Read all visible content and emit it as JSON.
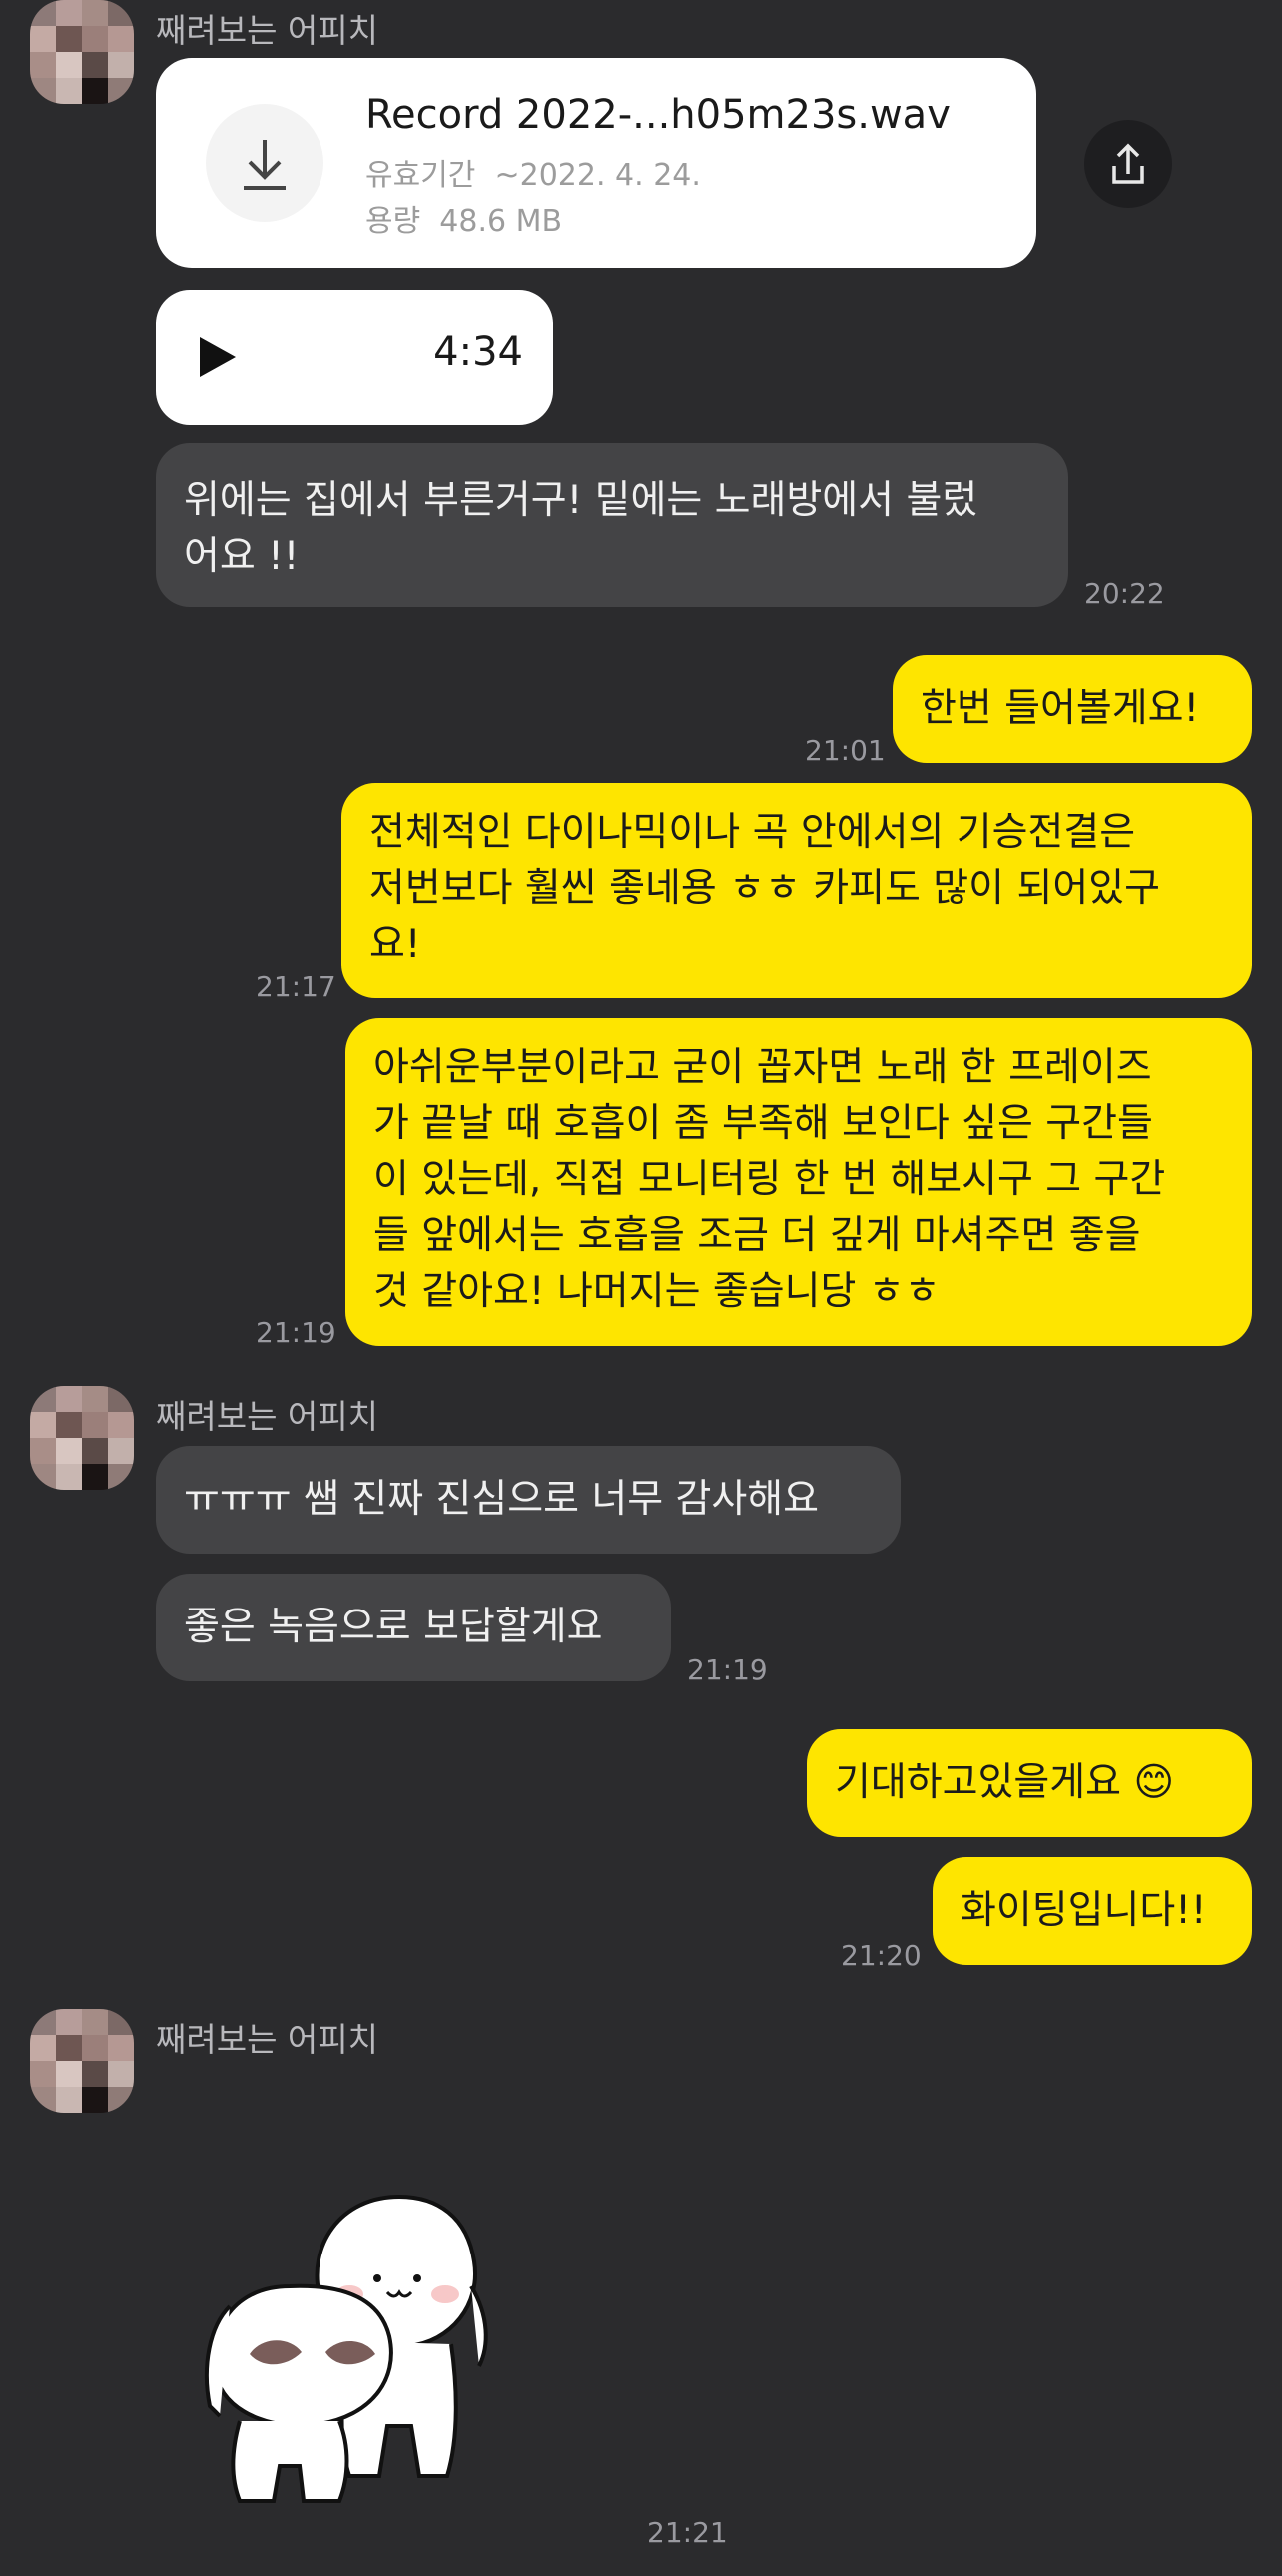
{
  "sender_name": "째려보는 어피치",
  "file_message": {
    "file_name": "Record 2022-...h05m23s.wav",
    "expiry_label": "유효기간",
    "expiry_value": "~2022. 4. 24.",
    "size_label": "용량",
    "size_value": "48.6 MB",
    "download_icon": "download-icon",
    "share_icon": "share-icon"
  },
  "audio_message": {
    "duration": "4:34",
    "play_icon": "play-icon"
  },
  "messages": [
    {
      "side": "in",
      "lines": [
        "위에는 집에서 부른거구! 밑에는 노래방에서 불렀",
        "어요 !!"
      ],
      "time": "20:22"
    },
    {
      "side": "out",
      "lines": [
        "한번 들어볼게요!"
      ],
      "time": "21:01"
    },
    {
      "side": "out",
      "lines": [
        "전체적인 다이나믹이나 곡 안에서의 기승전결은",
        "저번보다 훨씬 좋네용 ㅎㅎ 카피도 많이 되어있구",
        "요!"
      ],
      "time": "21:17"
    },
    {
      "side": "out",
      "lines": [
        "아쉬운부분이라고 굳이 꼽자면 노래 한 프레이즈",
        "가 끝날 때 호흡이 좀 부족해 보인다 싶은 구간들",
        "이 있는데, 직접 모니터링 한 번 해보시구 그 구간",
        "들 앞에서는 호흡을 조금 더 깊게 마셔주면 좋을",
        "것 같아요! 나머지는 좋습니당 ㅎㅎ"
      ],
      "time": "21:19"
    },
    {
      "side": "in",
      "lines": [
        "ㅠㅠㅠ 쌤 진짜 진심으로 너무 감사해요"
      ],
      "time": ""
    },
    {
      "side": "in",
      "lines": [
        "좋은 녹음으로 보답할게요"
      ],
      "time": "21:19"
    },
    {
      "side": "out",
      "lines": [
        "기대하고있을게요 😊"
      ],
      "time": ""
    },
    {
      "side": "out",
      "lines": [
        "화이팅입니다!!"
      ],
      "time": "21:20"
    }
  ],
  "sticker": {
    "description": "two-white-cat-characters-sticker",
    "time": "21:21"
  },
  "colors": {
    "background": "#2b2b2d",
    "incoming_bubble": "#444446",
    "outgoing_bubble": "#fee500"
  }
}
